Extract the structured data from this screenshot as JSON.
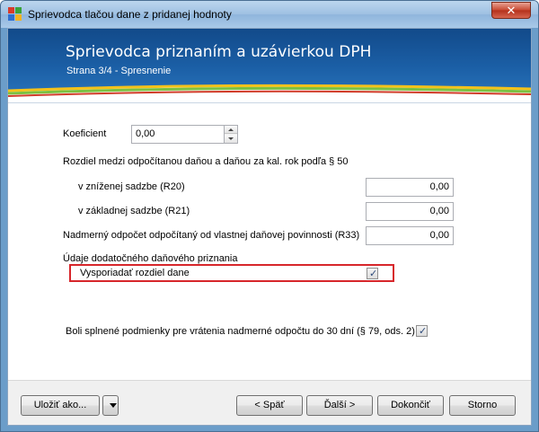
{
  "window": {
    "title": "Sprievodca tlačou dane z pridanej hodnoty",
    "close_label": "✕"
  },
  "banner": {
    "title": "Sprievodca priznaním a uzávierkou DPH",
    "subtitle": "Strana 3/4 - Spresnenie"
  },
  "form": {
    "koeficient_label": "Koeficient",
    "koeficient_value": "0,00",
    "rozdiel_heading": "Rozdiel medzi odpočítanou daňou a daňou za kal. rok podľa § 50",
    "r20_label": "v zníženej sadzbe (R20)",
    "r20_value": "0,00",
    "r21_label": "v základnej sadzbe (R21)",
    "r21_value": "0,00",
    "r33_label": "Nadmerný odpočet odpočítaný od vlastnej daňovej povinnosti (R33)",
    "r33_value": "0,00",
    "dodatocne_heading": "Údaje dodatočného daňového priznania",
    "vysporiadat_label": "Vysporiadať rozdiel dane",
    "vysporiadat_checked": true,
    "splnene_label": "Boli splnené podmienky pre vrátenia nadmerné odpočtu do 30 dní (§ 79, ods. 2)",
    "splnene_checked": true
  },
  "footer": {
    "save_as": "Uložiť ako...",
    "back": "< Späť",
    "next": "Ďalší >",
    "finish": "Dokončiť",
    "cancel": "Storno"
  },
  "colors": {
    "banner": "#1b5fa6",
    "highlight": "#d7262b"
  }
}
